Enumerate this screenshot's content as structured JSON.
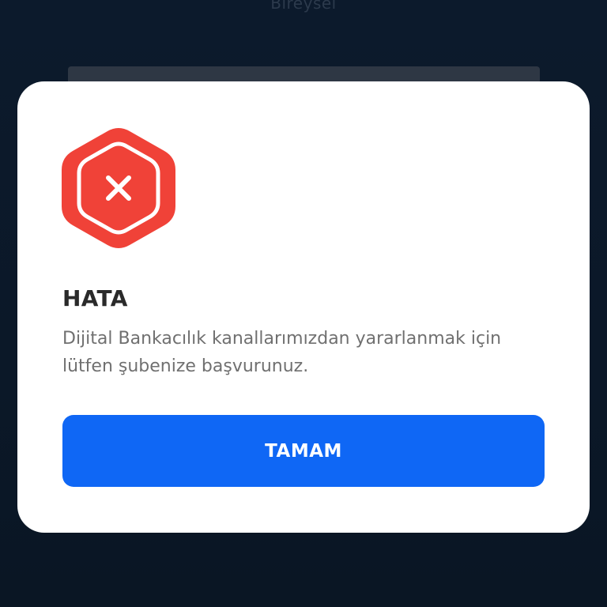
{
  "background": {
    "title": "Bireysel"
  },
  "dialog": {
    "icon": "error-x-hexagon-icon",
    "title": "HATA",
    "message": "Dijital Bankacılık kanallarımızdan yararlanmak için lütfen şubenize başvurunuz.",
    "button_label": "TAMAM"
  },
  "colors": {
    "error": "#f04238",
    "primary": "#0f67f5",
    "background": "#0c1a2c"
  }
}
